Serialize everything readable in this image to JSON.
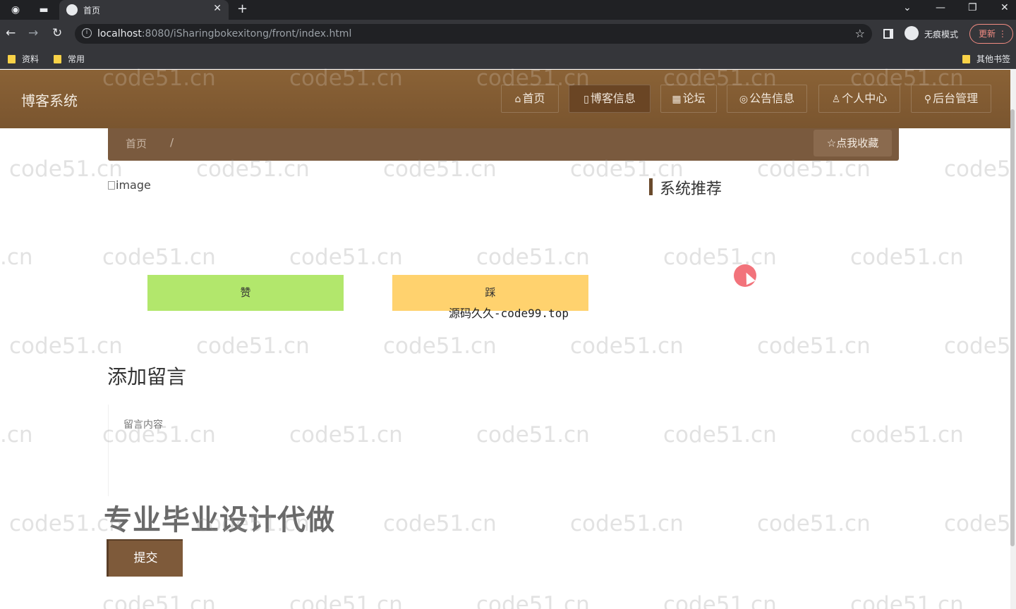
{
  "browser": {
    "tab_title": "首页",
    "url_host": "localhost",
    "url_rest": ":8080/iSharingbokexitong/front/index.html",
    "incognito_label": "无痕模式",
    "update_label": "更新",
    "bookmarks": [
      {
        "label": "资料"
      },
      {
        "label": "常用"
      }
    ],
    "other_bookmarks": "其他书签"
  },
  "site": {
    "title": "博客系统",
    "nav": [
      {
        "label": "首页",
        "icon": "home-icon"
      },
      {
        "label": "博客信息",
        "icon": "book-icon",
        "active": true
      },
      {
        "label": "论坛",
        "icon": "forum-icon"
      },
      {
        "label": "公告信息",
        "icon": "compass-icon"
      },
      {
        "label": "个人中心",
        "icon": "user-icon"
      },
      {
        "label": "后台管理",
        "icon": "link-icon"
      }
    ],
    "breadcrumb": {
      "home": "首页",
      "separator": "/"
    },
    "favorite_label": "点我收藏"
  },
  "content": {
    "image_alt": "image",
    "recommend_title": "系统推荐",
    "like_label": "赞",
    "dislike_label": "踩",
    "overlay_text": "源码久久-code99.top",
    "comment_section_title": "添加留言",
    "comment_placeholder": "留言内容",
    "promo_text": "专业毕业设计代做",
    "submit_label": "提交"
  },
  "watermark": "code51.cn",
  "watermark_partial_left": ".cn",
  "watermark_partial_right": "code5",
  "colors": {
    "header": "#7a552f",
    "like": "#b2e76c",
    "dislike": "#ffd26e",
    "submit": "#7e5a3a"
  }
}
